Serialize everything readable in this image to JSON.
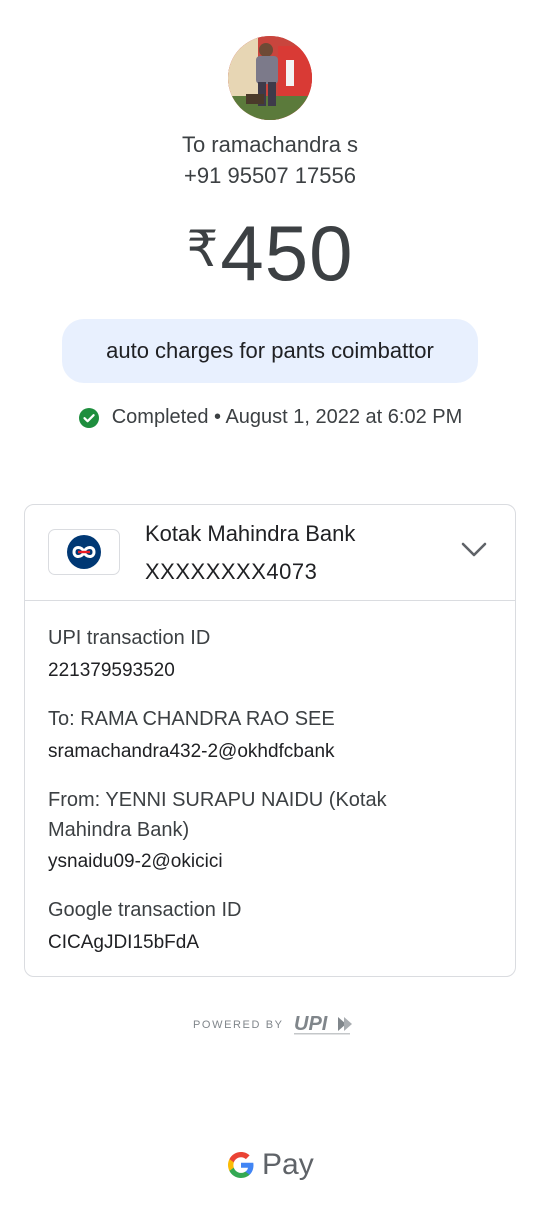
{
  "recipient": {
    "name_line": "To ramachandra s",
    "phone": "+91 95507 17556"
  },
  "amount": {
    "currency": "₹",
    "value": "450"
  },
  "note": "auto charges for pants coimbattor",
  "status": {
    "text": "Completed • August 1, 2022 at 6:02 PM",
    "color": "#1e8e3e"
  },
  "bank": {
    "name": "Kotak Mahindra Bank",
    "account": "XXXXXXXX4073",
    "logo_color": "#003874",
    "accent_color": "#ed1c24"
  },
  "details": {
    "upi_label": "UPI transaction ID",
    "upi_value": "221379593520",
    "to_label": "To: RAMA CHANDRA RAO SEE",
    "to_value": "sramachandra432-2@okhdfcbank",
    "from_label_line1": "From: YENNI SURAPU NAIDU (Kotak",
    "from_label_line2": "Mahindra Bank)",
    "from_value": "ysnaidu09-2@okicici",
    "google_label": "Google transaction ID",
    "google_value": "CICAgJDI15bFdA"
  },
  "footer": {
    "powered_by": "POWERED BY",
    "upi_logo": "UPI",
    "gpay_label": "Pay"
  },
  "icons": {
    "status": "check-circle-icon",
    "expand": "chevron-down-icon"
  }
}
